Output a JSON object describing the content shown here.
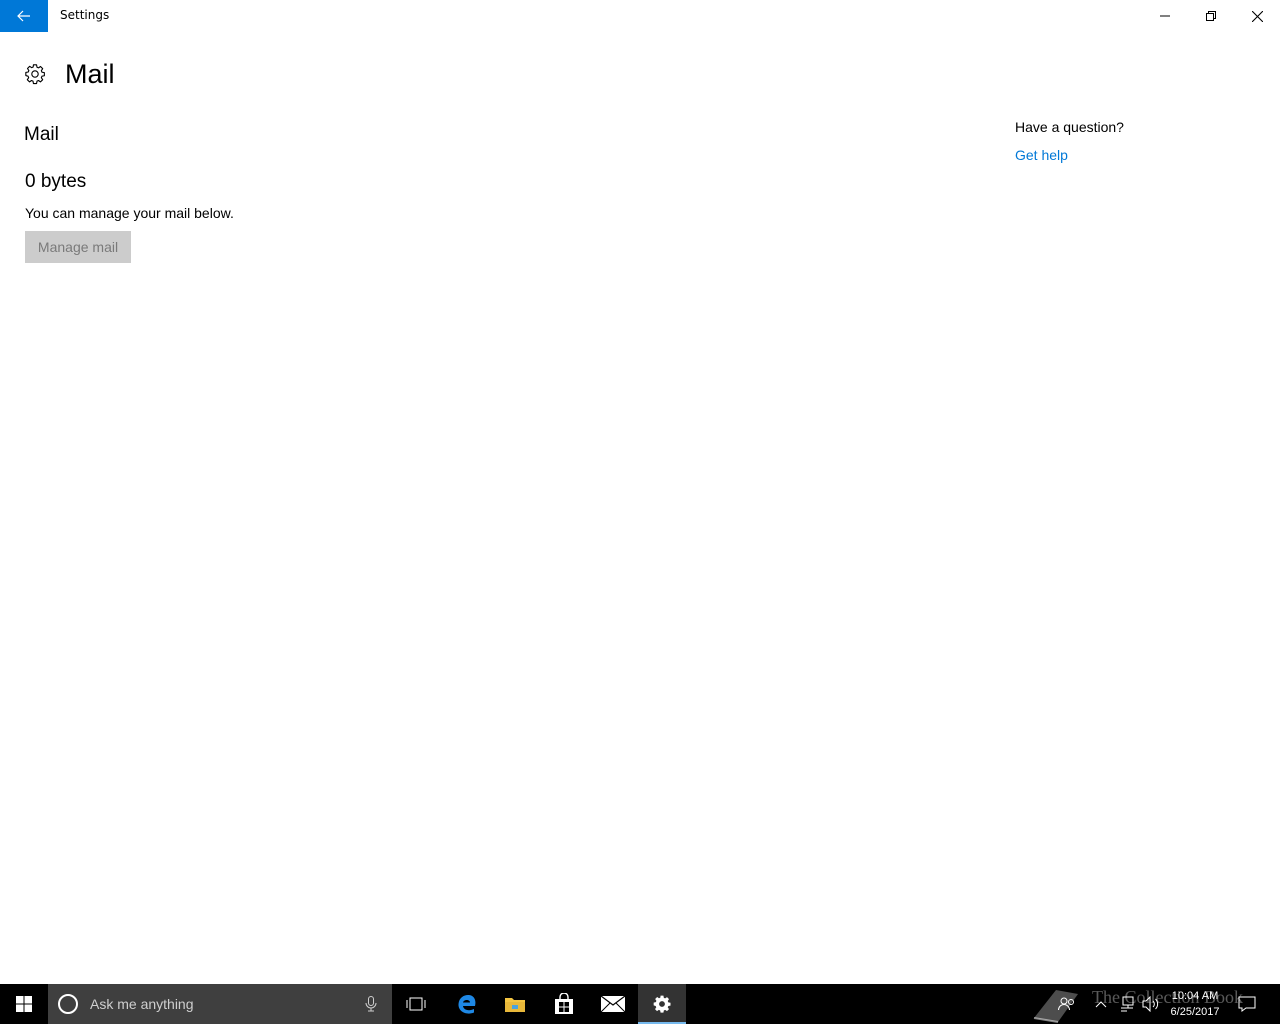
{
  "window": {
    "title": "Settings",
    "accent": "#0078d7"
  },
  "page": {
    "title": "Mail",
    "icon": "gear-icon"
  },
  "main": {
    "section_title": "Mail",
    "size_value": "0 bytes",
    "description": "You can manage your mail below.",
    "manage_button": "Manage mail"
  },
  "help": {
    "question": "Have a question?",
    "link": "Get help"
  },
  "taskbar": {
    "search_placeholder": "Ask me anything",
    "clock_time": "10:04 AM",
    "clock_date": "6/25/2017",
    "watermark": "The Collection Book",
    "apps": [
      "task-view-icon",
      "edge-icon",
      "file-explorer-icon",
      "store-icon",
      "mail-icon",
      "settings-icon"
    ]
  }
}
